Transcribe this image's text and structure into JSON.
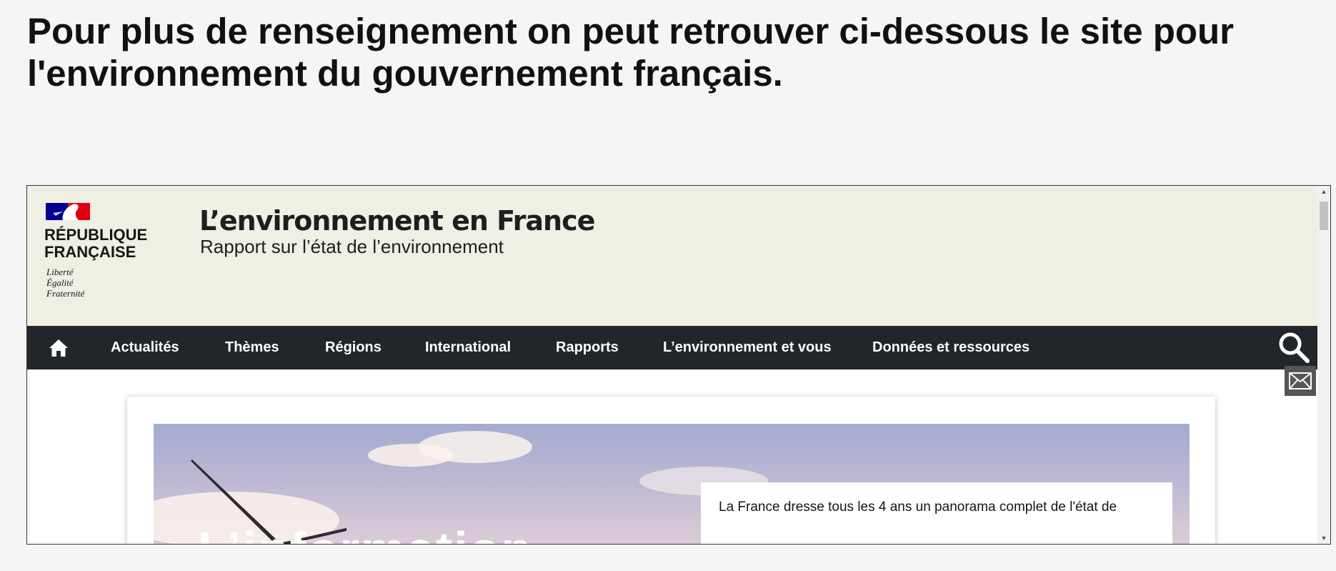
{
  "intro": {
    "text": "Pour plus de renseignement on peut retrouver ci-dessous le site pour l'environnement du gouvernement français."
  },
  "site": {
    "republique_line1": "RÉPUBLIQUE",
    "republique_line2": "FRANÇAISE",
    "motto": [
      "Liberté",
      "Égalité",
      "Fraternité"
    ],
    "title": "L’environnement en France",
    "subtitle": "Rapport sur l’état de l’environnement"
  },
  "nav": {
    "items": [
      "Actualités",
      "Thèmes",
      "Régions",
      "International",
      "Rapports",
      "L’environnement et vous",
      "Données et ressources"
    ]
  },
  "hero": {
    "partial_heading": "L’information",
    "info_text": "La France dresse tous les 4 ans un panorama complet de l'état de"
  },
  "icons": {
    "home": "home-icon",
    "search": "search-icon",
    "mail": "mail-icon"
  },
  "colors": {
    "header_bg": "#f0efe3",
    "nav_bg": "#22262b",
    "flag_blue": "#000091",
    "flag_red": "#e1000f"
  }
}
